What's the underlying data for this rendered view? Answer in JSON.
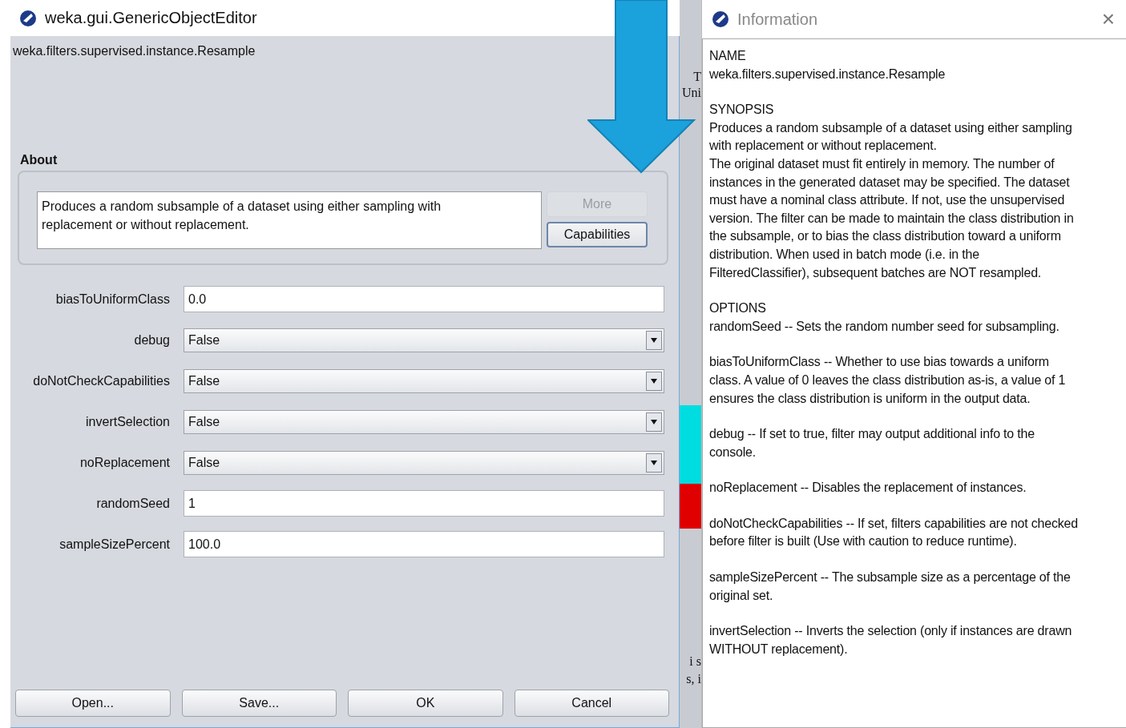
{
  "editor": {
    "title": "weka.gui.GenericObjectEditor",
    "class_name": "weka.filters.supervised.instance.Resample",
    "about_label": "About",
    "about_text": "Produces a random subsample of a dataset using either sampling with\nreplacement or without replacement.",
    "side_buttons": [
      {
        "label": "More",
        "disabled": true
      },
      {
        "label": "Capabilities",
        "disabled": false
      }
    ],
    "properties": [
      {
        "kind": "text",
        "label": "biasToUniformClass",
        "value": "0.0"
      },
      {
        "kind": "select",
        "label": "debug",
        "value": "False"
      },
      {
        "kind": "select",
        "label": "doNotCheckCapabilities",
        "value": "False"
      },
      {
        "kind": "select",
        "label": "invertSelection",
        "value": "False"
      },
      {
        "kind": "select",
        "label": "noReplacement",
        "value": "False"
      },
      {
        "kind": "text",
        "label": "randomSeed",
        "value": "1"
      },
      {
        "kind": "text",
        "label": "sampleSizePercent",
        "value": "100.0"
      }
    ],
    "buttons": [
      "Open...",
      "Save...",
      "OK",
      "Cancel"
    ]
  },
  "background_window": {
    "fragments": [
      "T",
      "Uni",
      "i s",
      "s, i"
    ]
  },
  "info": {
    "title": "Information",
    "close": "×",
    "paragraphs": [
      "NAME\nweka.filters.supervised.instance.Resample",
      "SYNOPSIS\nProduces a random subsample of a dataset using either sampling\nwith replacement or without replacement.\nThe original dataset must fit entirely in memory. The number of\ninstances in the generated dataset may be specified. The dataset\nmust have a nominal class attribute. If not, use the unsupervised\nversion. The filter can be made to maintain the class distribution in\nthe subsample, or to bias the class distribution toward a uniform\ndistribution. When used in batch mode (i.e. in the\nFilteredClassifier), subsequent batches are NOT resampled.",
      "OPTIONS\nrandomSeed -- Sets the random number seed for subsampling.",
      "biasToUniformClass -- Whether to use bias towards a uniform\nclass. A value of 0 leaves the class distribution as-is, a value of 1\nensures the class distribution is uniform in the output data.",
      "debug -- If set to true, filter may output additional info to the\nconsole.",
      "noReplacement -- Disables the replacement of instances.",
      "doNotCheckCapabilities -- If set, filters capabilities are not checked\nbefore filter is built (Use with caution to reduce runtime).",
      "sampleSizePercent -- The subsample size as a percentage of the\noriginal set.",
      "invertSelection -- Inverts the selection (only if instances are drawn\nWITHOUT replacement)."
    ]
  }
}
